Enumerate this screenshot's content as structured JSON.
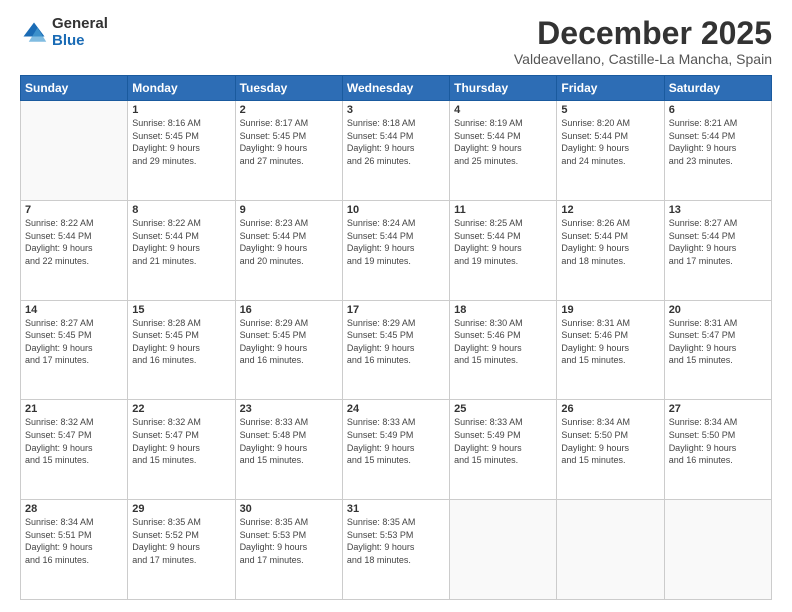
{
  "logo": {
    "general": "General",
    "blue": "Blue"
  },
  "header": {
    "title": "December 2025",
    "subtitle": "Valdeavellano, Castille-La Mancha, Spain"
  },
  "weekdays": [
    "Sunday",
    "Monday",
    "Tuesday",
    "Wednesday",
    "Thursday",
    "Friday",
    "Saturday"
  ],
  "weeks": [
    [
      {
        "day": "",
        "info": ""
      },
      {
        "day": "1",
        "info": "Sunrise: 8:16 AM\nSunset: 5:45 PM\nDaylight: 9 hours\nand 29 minutes."
      },
      {
        "day": "2",
        "info": "Sunrise: 8:17 AM\nSunset: 5:45 PM\nDaylight: 9 hours\nand 27 minutes."
      },
      {
        "day": "3",
        "info": "Sunrise: 8:18 AM\nSunset: 5:44 PM\nDaylight: 9 hours\nand 26 minutes."
      },
      {
        "day": "4",
        "info": "Sunrise: 8:19 AM\nSunset: 5:44 PM\nDaylight: 9 hours\nand 25 minutes."
      },
      {
        "day": "5",
        "info": "Sunrise: 8:20 AM\nSunset: 5:44 PM\nDaylight: 9 hours\nand 24 minutes."
      },
      {
        "day": "6",
        "info": "Sunrise: 8:21 AM\nSunset: 5:44 PM\nDaylight: 9 hours\nand 23 minutes."
      }
    ],
    [
      {
        "day": "7",
        "info": "Sunrise: 8:22 AM\nSunset: 5:44 PM\nDaylight: 9 hours\nand 22 minutes."
      },
      {
        "day": "8",
        "info": "Sunrise: 8:22 AM\nSunset: 5:44 PM\nDaylight: 9 hours\nand 21 minutes."
      },
      {
        "day": "9",
        "info": "Sunrise: 8:23 AM\nSunset: 5:44 PM\nDaylight: 9 hours\nand 20 minutes."
      },
      {
        "day": "10",
        "info": "Sunrise: 8:24 AM\nSunset: 5:44 PM\nDaylight: 9 hours\nand 19 minutes."
      },
      {
        "day": "11",
        "info": "Sunrise: 8:25 AM\nSunset: 5:44 PM\nDaylight: 9 hours\nand 19 minutes."
      },
      {
        "day": "12",
        "info": "Sunrise: 8:26 AM\nSunset: 5:44 PM\nDaylight: 9 hours\nand 18 minutes."
      },
      {
        "day": "13",
        "info": "Sunrise: 8:27 AM\nSunset: 5:44 PM\nDaylight: 9 hours\nand 17 minutes."
      }
    ],
    [
      {
        "day": "14",
        "info": "Sunrise: 8:27 AM\nSunset: 5:45 PM\nDaylight: 9 hours\nand 17 minutes."
      },
      {
        "day": "15",
        "info": "Sunrise: 8:28 AM\nSunset: 5:45 PM\nDaylight: 9 hours\nand 16 minutes."
      },
      {
        "day": "16",
        "info": "Sunrise: 8:29 AM\nSunset: 5:45 PM\nDaylight: 9 hours\nand 16 minutes."
      },
      {
        "day": "17",
        "info": "Sunrise: 8:29 AM\nSunset: 5:45 PM\nDaylight: 9 hours\nand 16 minutes."
      },
      {
        "day": "18",
        "info": "Sunrise: 8:30 AM\nSunset: 5:46 PM\nDaylight: 9 hours\nand 15 minutes."
      },
      {
        "day": "19",
        "info": "Sunrise: 8:31 AM\nSunset: 5:46 PM\nDaylight: 9 hours\nand 15 minutes."
      },
      {
        "day": "20",
        "info": "Sunrise: 8:31 AM\nSunset: 5:47 PM\nDaylight: 9 hours\nand 15 minutes."
      }
    ],
    [
      {
        "day": "21",
        "info": "Sunrise: 8:32 AM\nSunset: 5:47 PM\nDaylight: 9 hours\nand 15 minutes."
      },
      {
        "day": "22",
        "info": "Sunrise: 8:32 AM\nSunset: 5:47 PM\nDaylight: 9 hours\nand 15 minutes."
      },
      {
        "day": "23",
        "info": "Sunrise: 8:33 AM\nSunset: 5:48 PM\nDaylight: 9 hours\nand 15 minutes."
      },
      {
        "day": "24",
        "info": "Sunrise: 8:33 AM\nSunset: 5:49 PM\nDaylight: 9 hours\nand 15 minutes."
      },
      {
        "day": "25",
        "info": "Sunrise: 8:33 AM\nSunset: 5:49 PM\nDaylight: 9 hours\nand 15 minutes."
      },
      {
        "day": "26",
        "info": "Sunrise: 8:34 AM\nSunset: 5:50 PM\nDaylight: 9 hours\nand 15 minutes."
      },
      {
        "day": "27",
        "info": "Sunrise: 8:34 AM\nSunset: 5:50 PM\nDaylight: 9 hours\nand 16 minutes."
      }
    ],
    [
      {
        "day": "28",
        "info": "Sunrise: 8:34 AM\nSunset: 5:51 PM\nDaylight: 9 hours\nand 16 minutes."
      },
      {
        "day": "29",
        "info": "Sunrise: 8:35 AM\nSunset: 5:52 PM\nDaylight: 9 hours\nand 17 minutes."
      },
      {
        "day": "30",
        "info": "Sunrise: 8:35 AM\nSunset: 5:53 PM\nDaylight: 9 hours\nand 17 minutes."
      },
      {
        "day": "31",
        "info": "Sunrise: 8:35 AM\nSunset: 5:53 PM\nDaylight: 9 hours\nand 18 minutes."
      },
      {
        "day": "",
        "info": ""
      },
      {
        "day": "",
        "info": ""
      },
      {
        "day": "",
        "info": ""
      }
    ]
  ]
}
